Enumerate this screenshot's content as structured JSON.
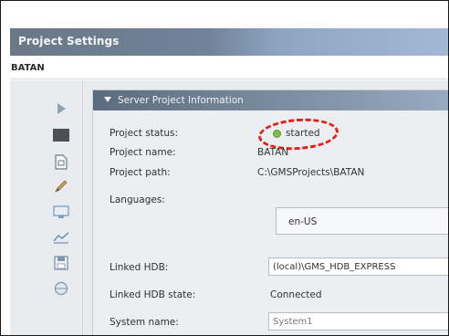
{
  "window": {
    "title": "Project Settings"
  },
  "project": {
    "name": "BATAN"
  },
  "toolbar": {
    "items": [
      {
        "icon": "play-icon"
      },
      {
        "icon": "stop-icon"
      },
      {
        "icon": "document-icon"
      },
      {
        "icon": "pencil-icon"
      },
      {
        "icon": "monitor-icon"
      },
      {
        "icon": "chart-icon"
      },
      {
        "icon": "save-icon"
      },
      {
        "icon": "globe-icon"
      }
    ]
  },
  "panel": {
    "title": "Server Project Information",
    "fields": {
      "status": {
        "label": "Project status:",
        "value": "started",
        "color": "#7fbf4d"
      },
      "name": {
        "label": "Project name:",
        "value": "BATAN"
      },
      "path": {
        "label": "Project path:",
        "value": "C:\\GMSProjects\\BATAN"
      },
      "languages": {
        "label": "Languages:",
        "value": "en-US"
      },
      "linked_hdb": {
        "label": "Linked HDB:",
        "value": "(local)\\GMS_HDB_EXPRESS"
      },
      "linked_hdb_state": {
        "label": "Linked HDB state:",
        "value": "Connected"
      },
      "system_name": {
        "label": "System name:",
        "value": "System1"
      }
    }
  },
  "colors": {
    "highlight_ring": "#e3201b",
    "title_bar": "#71839a",
    "status_started": "#7fbf4d"
  }
}
